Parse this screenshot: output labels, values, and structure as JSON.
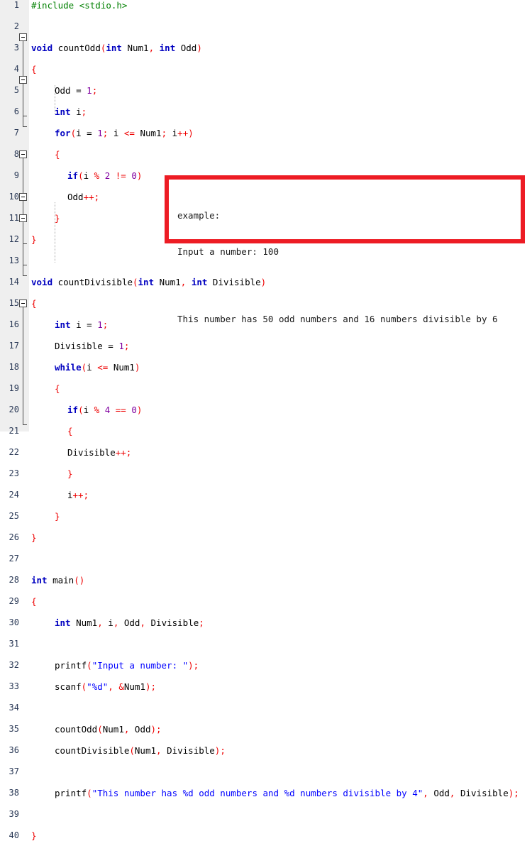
{
  "editor": {
    "gutter_bg": "#efefef",
    "background": "#ffffff",
    "line_count": 40
  },
  "colors": {
    "keyword": "#0000c0",
    "preprocessor": "#008000",
    "string": "#0000ff",
    "number": "#8000a0",
    "operator": "#ee0000",
    "identifier": "#000000",
    "line_number": "#2b3a57",
    "annotation_border": "#ed1c24"
  },
  "line_numbers": [
    "1",
    "2",
    "3",
    "4",
    "5",
    "6",
    "7",
    "8",
    "9",
    "10",
    "11",
    "12",
    "13",
    "14",
    "15",
    "16",
    "17",
    "18",
    "19",
    "20",
    "21",
    "22",
    "23",
    "24",
    "25",
    "26",
    "27",
    "28",
    "29",
    "30",
    "31",
    "32",
    "33",
    "34",
    "35",
    "36",
    "37",
    "38",
    "39",
    "40"
  ],
  "code": {
    "l1": "#include <stdio.h>",
    "l2": "",
    "l3a": "void",
    "l3b": " countOdd",
    "l3c": "(",
    "l3d": "int",
    "l3e": " Num1",
    "l3f": ", ",
    "l3g": "int",
    "l3h": " Odd",
    "l3i": ")",
    "l4": "{",
    "l5a": "Odd = ",
    "l5b": "1",
    "l5c": ";",
    "l6a": "int",
    "l6b": " i",
    "l6c": ";",
    "l7a": "for",
    "l7b": "(",
    "l7c": "i = ",
    "l7d": "1",
    "l7e": "; ",
    "l7f": "i ",
    "l7g": "<=",
    "l7h": " Num1",
    "l7i": "; ",
    "l7j": "i",
    "l7k": "++",
    "l7l": ")",
    "l8": "{",
    "l9a": "if",
    "l9b": "(",
    "l9c": "i ",
    "l9d": "%",
    "l9e": " ",
    "l9f": "2",
    "l9g": " ",
    "l9h": "!=",
    "l9i": " ",
    "l9j": "0",
    "l9k": ")",
    "l10a": "Odd",
    "l10b": "++",
    "l10c": ";",
    "l11": "}",
    "l12": "}",
    "l13": "",
    "l14a": "void",
    "l14b": " countDivisible",
    "l14c": "(",
    "l14d": "int",
    "l14e": " Num1",
    "l14f": ", ",
    "l14g": "int",
    "l14h": " Divisible",
    "l14i": ")",
    "l15": "{",
    "l16a": "int",
    "l16b": " i = ",
    "l16c": "1",
    "l16d": ";",
    "l17a": "Divisible = ",
    "l17b": "1",
    "l17c": ";",
    "l18a": "while",
    "l18b": "(",
    "l18c": "i ",
    "l18d": "<=",
    "l18e": " Num1",
    "l18f": ")",
    "l19": "{",
    "l20a": "if",
    "l20b": "(",
    "l20c": "i ",
    "l20d": "%",
    "l20e": " ",
    "l20f": "4",
    "l20g": " ",
    "l20h": "==",
    "l20i": " ",
    "l20j": "0",
    "l20k": ")",
    "l21": "{",
    "l22a": "Divisible",
    "l22b": "++",
    "l22c": ";",
    "l23": "}",
    "l24a": "i",
    "l24b": "++",
    "l24c": ";",
    "l25": "}",
    "l26": "}",
    "l27": "",
    "l28a": "int",
    "l28b": " main",
    "l28c": "()",
    "l29": "{",
    "l30a": "int",
    "l30b": " Num1",
    "l30c": ", ",
    "l30d": "i",
    "l30e": ", ",
    "l30f": "Odd",
    "l30g": ", ",
    "l30h": "Divisible",
    "l30i": ";",
    "l31": "",
    "l32a": "printf",
    "l32b": "(",
    "l32c": "\"Input a number: \"",
    "l32d": ");",
    "l33a": "scanf",
    "l33b": "(",
    "l33c": "\"%d\"",
    "l33d": ", ",
    "l33e": "&",
    "l33f": "Num1",
    "l33g": ");",
    "l34": "",
    "l35a": "countOdd",
    "l35b": "(",
    "l35c": "Num1",
    "l35d": ", ",
    "l35e": "Odd",
    "l35f": ");",
    "l36a": "countDivisible",
    "l36b": "(",
    "l36c": "Num1",
    "l36d": ", ",
    "l36e": "Divisible",
    "l36f": ");",
    "l37": "",
    "l38a": "printf",
    "l38b": "(",
    "l38c": "\"This number has %d odd numbers and %d numbers divisible by 4\"",
    "l38d": ", ",
    "l38e": "Odd",
    "l38f": ", ",
    "l38g": "Divisible",
    "l38h": ");",
    "l39": "",
    "l40": "}"
  },
  "annotation": {
    "line1": "example:",
    "line2": "Input a number: 100",
    "line3": "This number has 50 odd numbers and 16 numbers divisible by 6"
  }
}
